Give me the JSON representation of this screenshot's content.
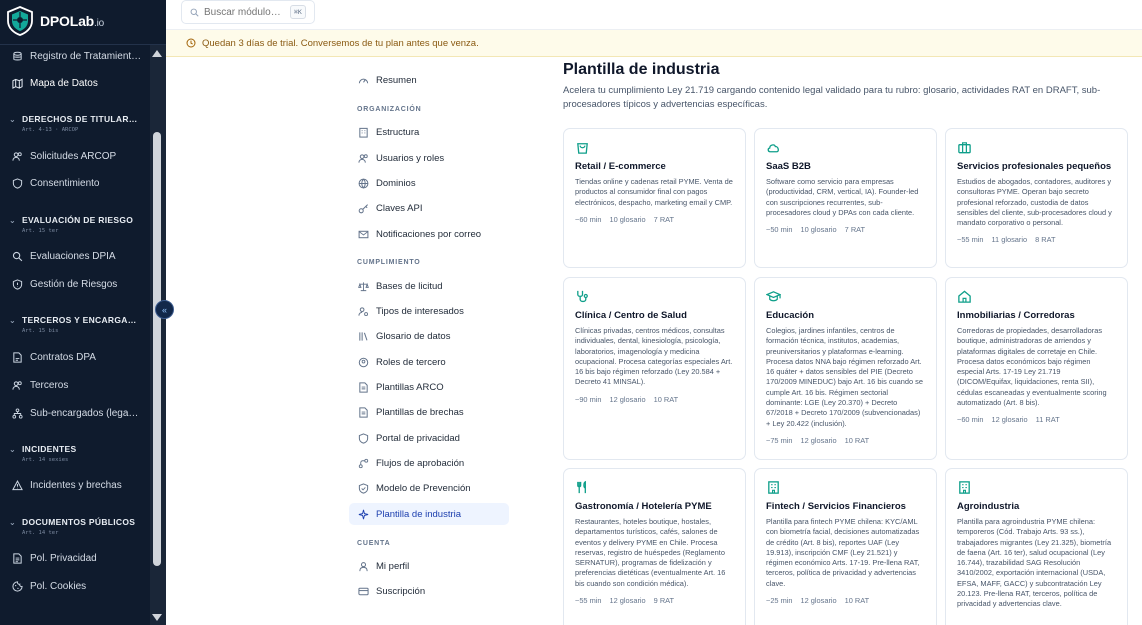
{
  "brand": {
    "name": "DPOLab",
    "suffix": ".io"
  },
  "sidebar": {
    "items": [
      {
        "label": "Registro de Tratamient…",
        "icon": "database-icon"
      },
      {
        "label": "Mapa de Datos",
        "icon": "map-icon"
      }
    ],
    "sections": [
      {
        "title": "DERECHOS DE TITULAR…",
        "subtitle": "Art. 4-13 · ARCOP",
        "items": [
          {
            "label": "Solicitudes ARCOP",
            "icon": "users-icon"
          },
          {
            "label": "Consentimiento",
            "icon": "shield-icon"
          }
        ]
      },
      {
        "title": "EVALUACIÓN DE RIESGO",
        "subtitle": "Art. 15 ter",
        "items": [
          {
            "label": "Evaluaciones DPIA",
            "icon": "search-icon"
          },
          {
            "label": "Gestión de Riesgos",
            "icon": "shield-alert-icon"
          }
        ]
      },
      {
        "title": "TERCEROS Y ENCARGA…",
        "subtitle": "Art. 15 bis",
        "items": [
          {
            "label": "Contratos DPA",
            "icon": "contract-icon"
          },
          {
            "label": "Terceros",
            "icon": "users-icon"
          },
          {
            "label": "Sub-encargados (lega…",
            "icon": "network-icon"
          }
        ]
      },
      {
        "title": "INCIDENTES",
        "subtitle": "Art. 14 sexies",
        "items": [
          {
            "label": "Incidentes y brechas",
            "icon": "warning-icon"
          }
        ]
      },
      {
        "title": "DOCUMENTOS PÚBLICOS",
        "subtitle": "Art. 14 ter",
        "items": [
          {
            "label": "Pol. Privacidad",
            "icon": "document-icon"
          },
          {
            "label": "Pol. Cookies",
            "icon": "cookie-icon"
          }
        ]
      }
    ]
  },
  "search": {
    "placeholder": "Buscar módulo…",
    "shortcut": "⌘K"
  },
  "trial_banner": {
    "text": "Quedan 3 días de trial. Conversemos de tu plan antes que venza."
  },
  "settings_menu": {
    "top_item": "Resumen",
    "sections": [
      {
        "title": "ORGANIZACIÓN",
        "items": [
          "Estructura",
          "Usuarios y roles",
          "Dominios",
          "Claves API",
          "Notificaciones por correo"
        ]
      },
      {
        "title": "CUMPLIMIENTO",
        "items": [
          "Bases de licitud",
          "Tipos de interesados",
          "Glosario de datos",
          "Roles de tercero",
          "Plantillas ARCO",
          "Plantillas de brechas",
          "Portal de privacidad",
          "Flujos de aprobación",
          "Modelo de Prevención",
          "Plantilla de industria"
        ]
      },
      {
        "title": "CUENTA",
        "items": [
          "Mi perfil",
          "Suscripción"
        ]
      }
    ],
    "active": "Plantilla de industria"
  },
  "page": {
    "title": "Plantilla de industria",
    "description": "Acelera tu cumplimiento Ley 21.719 cargando contenido legal validado para tu rubro: glosario, actividades RAT en DRAFT, sub-procesadores típicos y advertencias específicas."
  },
  "cards": [
    {
      "title": "Retail / E-commerce",
      "icon": "shopping-bag-icon",
      "description": "Tiendas online y cadenas retail PYME. Venta de productos al consumidor final con pagos electrónicos, despacho, marketing email y CMP.",
      "time": "~60 min",
      "glossary": "10 glosario",
      "rat": "7 RAT"
    },
    {
      "title": "SaaS B2B",
      "icon": "cloud-icon",
      "description": "Software como servicio para empresas (productividad, CRM, vertical, IA). Founder-led con suscripciones recurrentes, sub-procesadores cloud y DPAs con cada cliente.",
      "time": "~50 min",
      "glossary": "10 glosario",
      "rat": "7 RAT"
    },
    {
      "title": "Servicios profesionales pequeños",
      "icon": "briefcase-icon",
      "description": "Estudios de abogados, contadores, auditores y consultoras PYME. Operan bajo secreto profesional reforzado, custodia de datos sensibles del cliente, sub-procesadores cloud y mandato corporativo o personal.",
      "time": "~55 min",
      "glossary": "11 glosario",
      "rat": "8 RAT"
    },
    {
      "title": "Clínica / Centro de Salud",
      "icon": "stethoscope-icon",
      "description": "Clínicas privadas, centros médicos, consultas individuales, dental, kinesiología, psicología, laboratorios, imagenología y medicina ocupacional. Procesa categorías especiales Art. 16 bis bajo régimen reforzado (Ley 20.584 + Decreto 41 MINSAL).",
      "time": "~90 min",
      "glossary": "12 glosario",
      "rat": "10 RAT"
    },
    {
      "title": "Educación",
      "icon": "graduation-cap-icon",
      "description": "Colegios, jardines infantiles, centros de formación técnica, institutos, academias, preuniversitarios y plataformas e-learning. Procesa datos NNA bajo régimen reforzado Art. 16 quáter + datos sensibles del PIE (Decreto 170/2009 MINEDUC) bajo Art. 16 bis cuando se cumple Art. 16 bis. Régimen sectorial dominante: LGE (Ley 20.370) + Decreto 67/2018 + Decreto 170/2009 (subvencionadas) + Ley 20.422 (inclusión).",
      "time": "~75 min",
      "glossary": "12 glosario",
      "rat": "10 RAT"
    },
    {
      "title": "Inmobiliarias / Corredoras",
      "icon": "home-icon",
      "description": "Corredoras de propiedades, desarrolladoras boutique, administradoras de arriendos y plataformas digitales de corretaje en Chile. Procesa datos económicos bajo régimen especial Arts. 17-19 Ley 21.719 (DICOM/Equifax, liquidaciones, renta SII), cédulas escaneadas y eventualmente scoring automatizado (Art. 8 bis).",
      "time": "~60 min",
      "glossary": "12 glosario",
      "rat": "11 RAT"
    },
    {
      "title": "Gastronomía / Hotelería PYME",
      "icon": "utensils-icon",
      "description": "Restaurantes, hoteles boutique, hostales, departamentos turísticos, cafés, salones de eventos y delivery PYME en Chile. Procesa reservas, registro de huéspedes (Reglamento SERNATUR), programas de fidelización y preferencias dietéticas (eventualmente Art. 16 bis cuando son condición médica).",
      "time": "~55 min",
      "glossary": "12 glosario",
      "rat": "9 RAT"
    },
    {
      "title": "Fintech / Servicios Financieros",
      "icon": "building-icon",
      "description": "Plantilla para fintech PYME chilena: KYC/AML con biometría facial, decisiones automatizadas de crédito (Art. 8 bis), reportes UAF (Ley 19.913), inscripción CMF (Ley 21.521) y régimen económico Arts. 17-19. Pre-llena RAT, terceros, política de privacidad y advertencias clave.",
      "time": "~25 min",
      "glossary": "12 glosario",
      "rat": "10 RAT"
    },
    {
      "title": "Agroindustria",
      "icon": "building-icon",
      "description": "Plantilla para agroindustria PYME chilena: temporeros (Cód. Trabajo Arts. 93 ss.), trabajadores migrantes (Ley 21.325), biometría de faena (Art. 16 ter), salud ocupacional (Ley 16.744), trazabilidad SAG Resolución 3410/2002, exportación internacional (USDA, EFSA, MAFF, GACC) y subcontratación Ley 20.123. Pre-llena RAT, terceros, política de privacidad y advertencias clave.",
      "time": "",
      "glossary": "",
      "rat": ""
    }
  ],
  "colors": {
    "sidebar_bg": "#0f1b2d",
    "accent": "#0f9f8a",
    "banner_bg": "#fefbea",
    "banner_text": "#8a5a12",
    "active_bg": "#eef4ff"
  }
}
